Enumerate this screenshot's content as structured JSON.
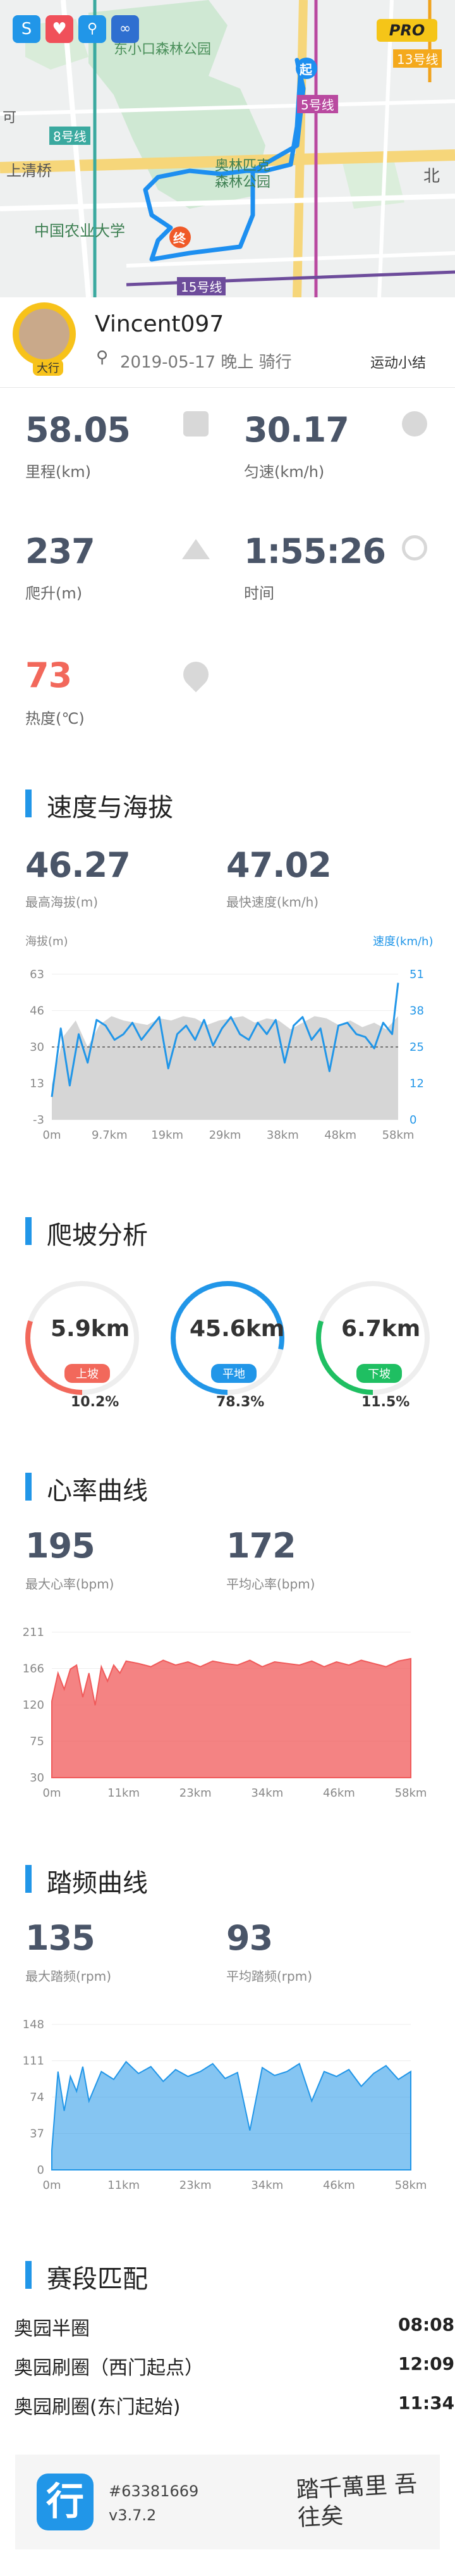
{
  "top_icons": [
    "strava-icon",
    "heart-icon",
    "cycle-icon",
    "route-icon"
  ],
  "pro_badge": "PRO",
  "map": {
    "labels": {
      "park_north": "东小口森林公园",
      "line13": "13号线",
      "line8": "8号线",
      "line5": "5号线",
      "qinghe": "上清桥",
      "olympic": "奥林匹克\n森林公园",
      "north": "北",
      "cau": "中国农业大学",
      "line15": "15号线",
      "road_s": "可"
    },
    "start_marker": "起",
    "end_marker": "终"
  },
  "user": {
    "name": "Vincent097",
    "sub": "2019-05-17 晚上 骑行",
    "avatar_tag": "大行",
    "summary_link": "运动小结"
  },
  "stats": {
    "distance": {
      "value": "58.05",
      "label": "里程(km)"
    },
    "speed": {
      "value": "30.17",
      "label": "匀速(km/h)"
    },
    "climb": {
      "value": "237",
      "label": "爬升(m)"
    },
    "time": {
      "value": "1:55:26",
      "label": "时间"
    },
    "calories": {
      "value": "73",
      "label": "热度(℃)"
    }
  },
  "sections": {
    "speed_alt": "速度与海拔",
    "climb": "爬坡分析",
    "heart": "心率曲线",
    "cadence": "踏频曲线",
    "segments": "赛段匹配"
  },
  "speed_alt": {
    "max_alt": {
      "value": "46.27",
      "label": "最高海拔(m)"
    },
    "max_speed": {
      "value": "47.02",
      "label": "最快速度(km/h)"
    },
    "left_axis_title": "海拔(m)",
    "right_axis_title": "速度(km/h)"
  },
  "climb_analysis": [
    {
      "value": "5.9km",
      "tag": "上坡",
      "pct": "10.2%",
      "color": "#f2685b",
      "fraction": 0.102
    },
    {
      "value": "45.6km",
      "tag": "平地",
      "pct": "78.3%",
      "color": "#2196e8",
      "fraction": 0.783
    },
    {
      "value": "6.7km",
      "tag": "下坡",
      "pct": "11.5%",
      "color": "#1fbf62",
      "fraction": 0.115
    }
  ],
  "heart": {
    "max": {
      "value": "195",
      "label": "最大心率(bpm)"
    },
    "avg": {
      "value": "172",
      "label": "平均心率(bpm)"
    }
  },
  "cadence": {
    "max": {
      "value": "135",
      "label": "最大踏频(rpm)"
    },
    "avg": {
      "value": "93",
      "label": "平均踏频(rpm)"
    }
  },
  "segments": [
    {
      "name": "奥园半圈",
      "time": "08:08"
    },
    {
      "name": "奥园刷圈（西门起点）",
      "time": "12:09"
    },
    {
      "name": "奥园刷圈(东门起始)",
      "time": "11:34"
    }
  ],
  "footer": {
    "id": "#63381669",
    "version": "v3.7.2",
    "logo_char": "行",
    "calligraphy": "踏千萬里 吾往矣"
  },
  "chart_data": [
    {
      "type": "line",
      "x_ticks": [
        "0m",
        "9.7km",
        "19km",
        "29km",
        "38km",
        "48km",
        "58km"
      ],
      "y_left_ticks": [
        "63",
        "46",
        "30",
        "13",
        "-3"
      ],
      "y_right_ticks": [
        "51",
        "38",
        "25",
        "12",
        "0"
      ],
      "ylim_left": [
        -3,
        63
      ],
      "ylim_right": [
        0,
        51
      ],
      "xlim": [
        0,
        58
      ],
      "series": [
        {
          "axis": "left",
          "color": "#d6d6d6",
          "x": [
            0,
            2,
            4,
            6,
            8,
            10,
            12,
            14,
            16,
            18,
            20,
            22,
            24,
            26,
            28,
            30,
            32,
            34,
            36,
            38,
            40,
            42,
            44,
            46,
            48,
            50,
            52,
            54,
            56,
            58
          ],
          "values": [
            13,
            35,
            42,
            30,
            40,
            44,
            42,
            41,
            40,
            43,
            42,
            44,
            43,
            40,
            42,
            43,
            44,
            41,
            43,
            42,
            38,
            41,
            44,
            43,
            40,
            42,
            39,
            41,
            38,
            44
          ]
        },
        {
          "axis": "right",
          "color": "#2196e8",
          "x": [
            0,
            1.5,
            3,
            4.5,
            6,
            7.5,
            9,
            10.5,
            12,
            13.5,
            15,
            16.5,
            18,
            19.5,
            21,
            22.5,
            24,
            25.5,
            27,
            28.5,
            30,
            31.5,
            33,
            34.5,
            36,
            37.5,
            39,
            40.5,
            42,
            43.5,
            45,
            46.5,
            48,
            49.5,
            51,
            52.5,
            54,
            55.5,
            57,
            58
          ],
          "values": [
            8,
            32,
            12,
            30,
            20,
            35,
            33,
            28,
            30,
            34,
            28,
            32,
            36,
            18,
            30,
            33,
            28,
            35,
            26,
            32,
            36,
            30,
            28,
            34,
            30,
            35,
            20,
            33,
            36,
            28,
            32,
            17,
            33,
            34,
            30,
            29,
            25,
            34,
            30,
            48
          ]
        }
      ],
      "dashed_avg_left": 30
    },
    {
      "type": "area",
      "x_ticks": [
        "0m",
        "11km",
        "23km",
        "34km",
        "46km",
        "58km"
      ],
      "y_ticks": [
        "211",
        "166",
        "120",
        "75",
        "30"
      ],
      "ylim": [
        30,
        211
      ],
      "xlim": [
        0,
        58
      ],
      "series": [
        {
          "color": "#f05a5a",
          "x": [
            0,
            1,
            2,
            3,
            4,
            5,
            6,
            7,
            8,
            9,
            10,
            11,
            12,
            14,
            16,
            18,
            20,
            22,
            24,
            26,
            28,
            30,
            32,
            34,
            36,
            38,
            40,
            42,
            44,
            46,
            48,
            50,
            52,
            54,
            56,
            58
          ],
          "values": [
            125,
            160,
            140,
            165,
            170,
            130,
            160,
            120,
            168,
            150,
            170,
            160,
            175,
            172,
            168,
            176,
            170,
            174,
            168,
            175,
            172,
            170,
            176,
            168,
            174,
            172,
            170,
            175,
            168,
            174,
            170,
            176,
            172,
            168,
            175,
            178
          ]
        }
      ]
    },
    {
      "type": "area",
      "x_ticks": [
        "0m",
        "11km",
        "23km",
        "34km",
        "46km",
        "58km"
      ],
      "y_ticks": [
        "148",
        "111",
        "74",
        "37",
        "0"
      ],
      "ylim": [
        0,
        148
      ],
      "xlim": [
        0,
        58
      ],
      "series": [
        {
          "color": "#2196e8",
          "x": [
            0,
            1,
            2,
            3,
            4,
            5,
            6,
            8,
            10,
            12,
            14,
            16,
            18,
            20,
            22,
            24,
            26,
            28,
            30,
            32,
            34,
            36,
            38,
            40,
            42,
            44,
            46,
            48,
            50,
            52,
            54,
            56,
            58
          ],
          "values": [
            20,
            100,
            60,
            95,
            80,
            105,
            70,
            100,
            92,
            110,
            98,
            105,
            90,
            102,
            95,
            100,
            108,
            93,
            99,
            40,
            104,
            96,
            100,
            108,
            70,
            100,
            95,
            102,
            85,
            98,
            106,
            92,
            100
          ]
        }
      ]
    }
  ]
}
